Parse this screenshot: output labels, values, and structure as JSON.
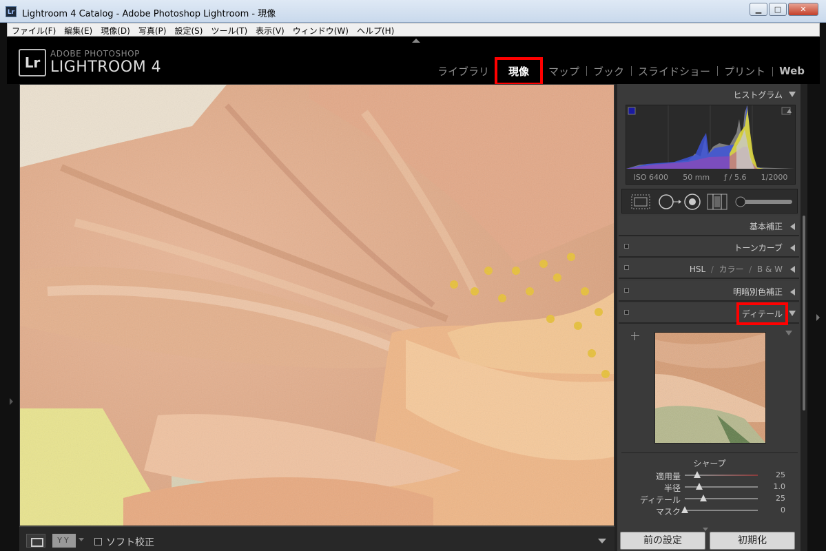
{
  "window": {
    "title": "Lightroom 4 Catalog - Adobe Photoshop Lightroom - 現像",
    "icon": "Lr",
    "min": "▁",
    "max": "□",
    "close": "✕"
  },
  "menu": [
    "ファイル(F)",
    "編集(E)",
    "現像(D)",
    "写真(P)",
    "設定(S)",
    "ツール(T)",
    "表示(V)",
    "ウィンドウ(W)",
    "ヘルプ(H)"
  ],
  "branding": {
    "badge": "Lr",
    "adobe": "ADOBE PHOTOSHOP",
    "product": "LIGHTROOM 4"
  },
  "modules": [
    "ライブラリ",
    "現像",
    "マップ",
    "ブック",
    "スライドショー",
    "プリント",
    "Web"
  ],
  "panel": {
    "histogram": {
      "label": "ヒストグラム",
      "iso": "ISO 6400",
      "focal": "50 mm",
      "aperture": "ƒ / 5.6",
      "shutter": "1/2000"
    },
    "basic": "基本補正",
    "tonecurve": "トーンカーブ",
    "hsl": {
      "a": "HSL",
      "b": "カラー",
      "c": "B & W",
      "sep": "/"
    },
    "splittone": "明暗別色補正",
    "detail": "ディテール",
    "sharpen": {
      "label": "シャープ",
      "rows": [
        {
          "label": "適用量",
          "value": "25",
          "pos": 0.17
        },
        {
          "label": "半径",
          "value": "1.0",
          "pos": 0.2
        },
        {
          "label": "ディテール",
          "value": "25",
          "pos": 0.25
        },
        {
          "label": "マスク",
          "value": "0",
          "pos": 0.0
        }
      ]
    },
    "buttons": {
      "previous": "前の設定",
      "reset": "初期化"
    }
  },
  "toolbar": {
    "yy": "YY",
    "softproof": "ソフト校正"
  },
  "colors": {
    "highlight": "#ff0000",
    "panel": "#3a3a3a"
  }
}
